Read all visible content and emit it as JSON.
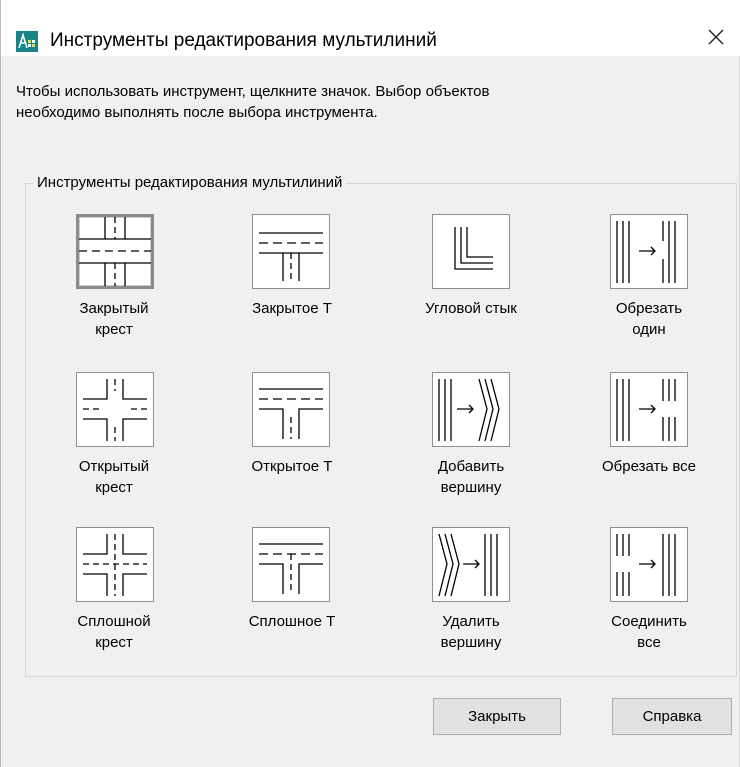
{
  "window": {
    "title": "Инструменты редактирования мультилиний",
    "close_glyph": "✕"
  },
  "instruction": "Чтобы использовать инструмент, щелкните значок.  Выбор объектов\nнеобходимо выполнять после выбора инструмента.",
  "group": {
    "label": "Инструменты редактирования мультилиний",
    "tools": [
      {
        "id": "closed-cross",
        "label": "Закрытый\nкрест",
        "icon": "closed-cross-icon",
        "selected": true
      },
      {
        "id": "closed-tee",
        "label": "Закрытое Т",
        "icon": "closed-tee-icon",
        "selected": false
      },
      {
        "id": "corner-joint",
        "label": "Угловой стык",
        "icon": "corner-joint-icon",
        "selected": false
      },
      {
        "id": "cut-single",
        "label": "Обрезать\nодин",
        "icon": "cut-single-icon",
        "selected": false
      },
      {
        "id": "open-cross",
        "label": "Открытый\nкрест",
        "icon": "open-cross-icon",
        "selected": false
      },
      {
        "id": "open-tee",
        "label": "Открытое Т",
        "icon": "open-tee-icon",
        "selected": false
      },
      {
        "id": "add-vertex",
        "label": "Добавить\nвершину",
        "icon": "add-vertex-icon",
        "selected": false
      },
      {
        "id": "cut-all",
        "label": "Обрезать все",
        "icon": "cut-all-icon",
        "selected": false
      },
      {
        "id": "merged-cross",
        "label": "Сплошной\nкрест",
        "icon": "merged-cross-icon",
        "selected": false
      },
      {
        "id": "merged-tee",
        "label": "Сплошное Т",
        "icon": "merged-tee-icon",
        "selected": false
      },
      {
        "id": "delete-vertex",
        "label": "Удалить\nвершину",
        "icon": "delete-vertex-icon",
        "selected": false
      },
      {
        "id": "weld-all",
        "label": "Соединить\nвсе",
        "icon": "weld-all-icon",
        "selected": false
      }
    ]
  },
  "buttons": {
    "close_label": "Закрыть",
    "help_label": "Справка"
  },
  "colors": {
    "dialog_bg": "#f0f0f0",
    "app_icon": "#17848a",
    "button_bg": "#e1e1e1"
  }
}
